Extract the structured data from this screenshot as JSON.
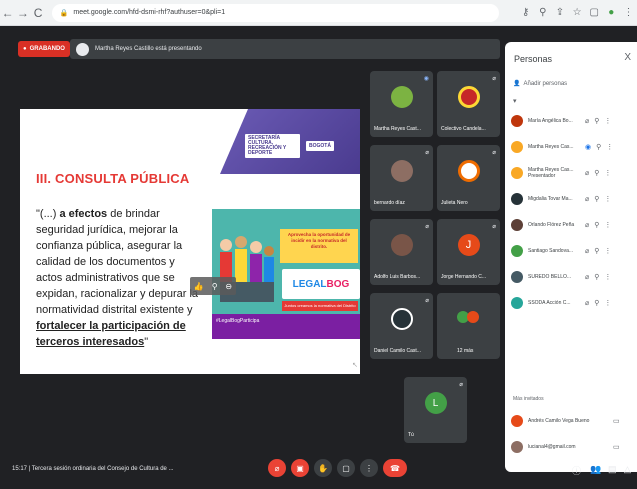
{
  "browser": {
    "back": "←",
    "forward": "→",
    "reload": "C",
    "url": "meet.google.com/hfd-dsmi-rhf?authuser=0&pli=1",
    "icons": [
      "key-icon",
      "search-icon",
      "share-icon",
      "star-icon",
      "tab-icon",
      "profile-icon",
      "menu-icon"
    ]
  },
  "meet": {
    "recording_label": "GRABANDO",
    "presenter_text": "Martha Reyes Castillo está presentando"
  },
  "slide": {
    "title": "III. CONSULTA PÚBLICA",
    "quote_pre": "\"(...) ",
    "quote_bold1": "a efectos",
    "quote_mid": " de brindar seguridad jurídica, mejorar la confianza pública, asegurar la calidad de los documentos y actos administrativos que se expidan, racionalizar y depurar la normatividad distrital existente y ",
    "quote_bold2": "fortalecer la participación de terceros interesados",
    "quote_end": "\"",
    "logo1": "SECRETARÍA CULTURA, RECREACIÓN Y DEPORTE",
    "logo2": "BOGOTÁ",
    "poster_banner": "Aprovecha la oportunidad de incidir en la normativa del distrito.",
    "poster_legal": "LEGAL",
    "poster_legal2": "BOG",
    "poster_subbanner": "Juntos creamos la normativa del Distrito",
    "poster_hashtag": "#LegalBogParticipa"
  },
  "tiles": [
    {
      "name": "Martha Reyes Cast...",
      "color": "#6d4c41"
    },
    {
      "name": "Colectivo Candela...",
      "color": "#c62828"
    },
    {
      "name": "bernardo díaz",
      "color": "#8d6e63"
    },
    {
      "name": "Julieta Nero",
      "color": "#ef6c00"
    },
    {
      "name": "Adolfo Luis Barbos...",
      "color": "#795548"
    },
    {
      "name": "Jorge Hernando C...",
      "color": "#e64a19"
    },
    {
      "name": "Daniel Camilo Cast...",
      "color": "#263238"
    },
    {
      "name": "12 más",
      "color": "#43a047"
    },
    {
      "name": "Tú",
      "color": "#43a047"
    }
  ],
  "tile_initials": {
    "jorge": "J",
    "you": "L"
  },
  "panel": {
    "title": "Personas",
    "close": "X",
    "add_people": "Añadir personas",
    "participants": [
      {
        "name": "María Angélica Bo...",
        "color": "#bf360c"
      },
      {
        "name": "Martha Reyes Cas...",
        "color": "#f9a825"
      },
      {
        "name": "Martha Reyes Cas... Presentador",
        "color": "#f9a825"
      },
      {
        "name": "Migdalia Tovar Ma...",
        "color": "#263238"
      },
      {
        "name": "Orlando Flórez Peña",
        "color": "#5d4037"
      },
      {
        "name": "Santiago Sandova...",
        "color": "#43a047"
      },
      {
        "name": "SUREDO BELLO...",
        "color": "#455a64"
      },
      {
        "name": "SSODA Acción C...",
        "color": "#26a69a"
      }
    ],
    "section_label": "Más invitados",
    "guests": [
      {
        "name": "Andrés Camilo Vega Bueno",
        "color": "#e64a19"
      },
      {
        "name": "lucianal4@gmail.com",
        "color": "#8d6e63"
      }
    ]
  },
  "bottom": {
    "meeting_info": "15:17 | Tercera sesión ordinaria del Consejo de Cultura de ..."
  }
}
